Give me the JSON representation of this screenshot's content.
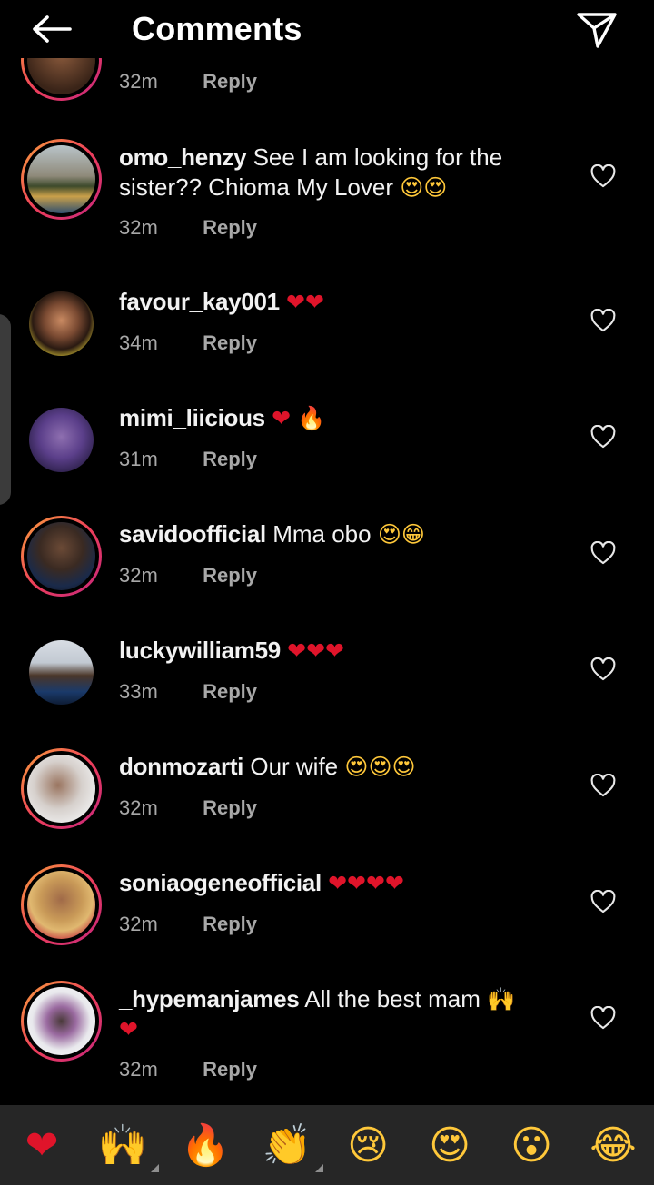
{
  "header": {
    "title": "Comments"
  },
  "partial_comment": {
    "time": "32m",
    "reply_label": "Reply"
  },
  "comments": [
    {
      "username": "omo_henzy",
      "text": "See I am looking for the",
      "text2": "sister?? Chioma My Lover",
      "emojis": "😍😍",
      "time": "32m",
      "reply_label": "Reply"
    },
    {
      "username": "favour_kay001",
      "text": "",
      "emojis": "❤❤",
      "time": "34m",
      "reply_label": "Reply"
    },
    {
      "username": "mimi_liicious",
      "text": "",
      "emojis": "❤",
      "emojis2": "🔥",
      "time": "31m",
      "reply_label": "Reply"
    },
    {
      "username": "savidoofficial",
      "text": "Mma obo",
      "emojis": "😍😁",
      "time": "32m",
      "reply_label": "Reply"
    },
    {
      "username": "luckywilliam59",
      "text": "",
      "emojis": "❤❤❤",
      "time": "33m",
      "reply_label": "Reply"
    },
    {
      "username": "donmozarti",
      "text": "Our wife",
      "emojis": "😍😍😍",
      "time": "32m",
      "reply_label": "Reply"
    },
    {
      "username": "soniaogeneofficial",
      "text": "",
      "emojis": "❤❤❤❤",
      "time": "32m",
      "reply_label": "Reply"
    },
    {
      "username": "_hypemanjames",
      "text": "All the best mam",
      "emojis": "🙌",
      "emojis2": "❤",
      "time": "32m",
      "reply_label": "Reply"
    }
  ],
  "reactions": [
    "❤",
    "🙌",
    "🔥",
    "👏",
    "😢",
    "😍",
    "😮",
    "😂"
  ],
  "colors": {
    "background": "#000000",
    "reaction_bar": "#262626",
    "muted_text": "#a8a8a8",
    "story_ring": "#ee3f5a"
  }
}
